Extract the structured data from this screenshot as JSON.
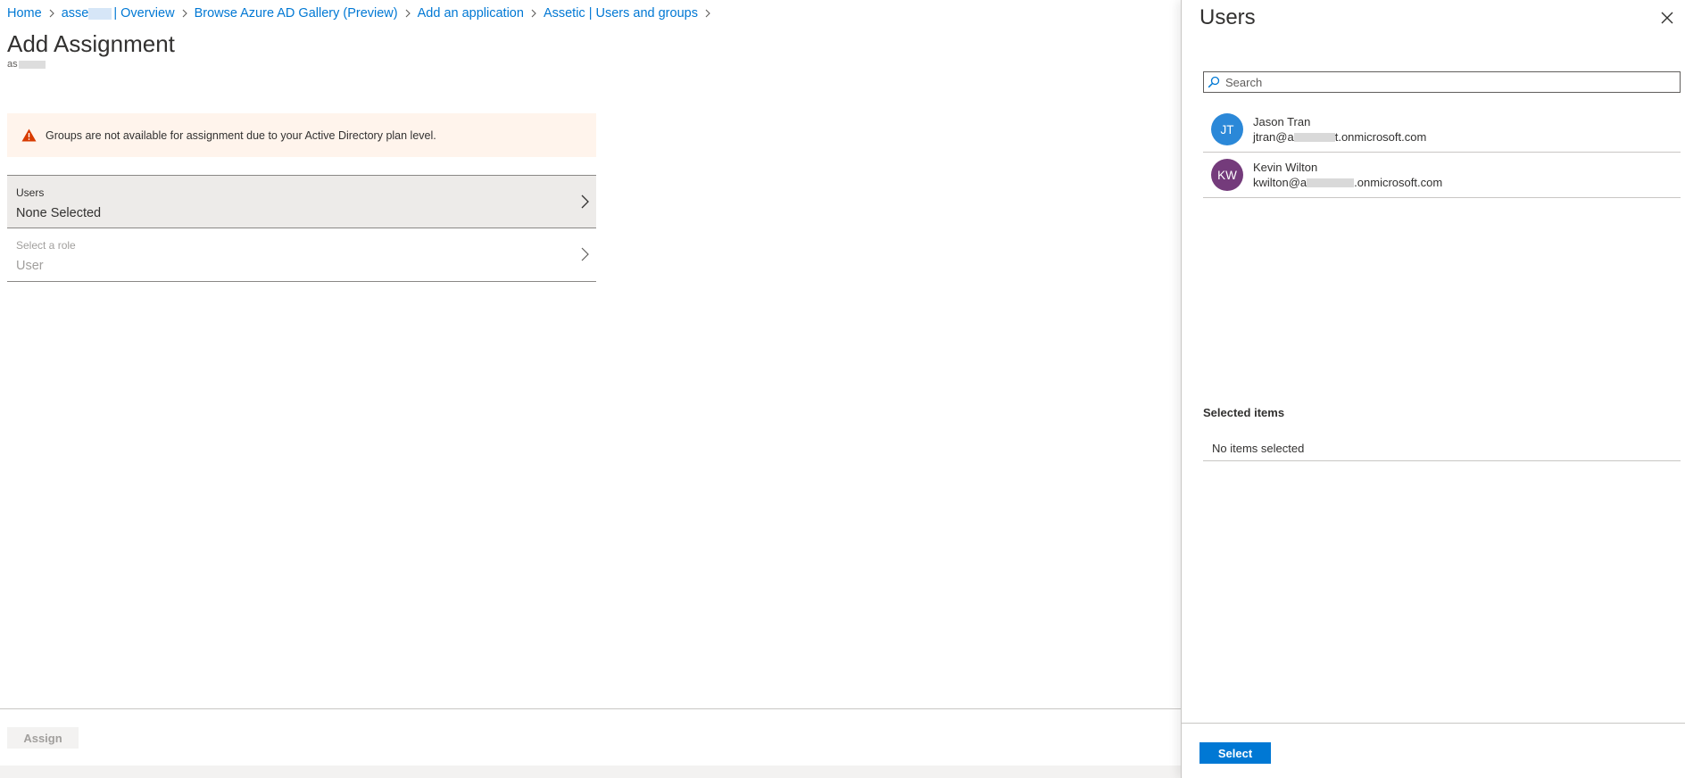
{
  "breadcrumb": {
    "items": [
      {
        "label": "Home"
      },
      {
        "label": "asse"
      },
      {
        "label": "| Overview"
      },
      {
        "label": "Browse Azure AD Gallery (Preview)"
      },
      {
        "label": "Add an application"
      },
      {
        "label": "Assetic | Users and groups"
      }
    ]
  },
  "page": {
    "title": "Add Assignment",
    "subtitle": "as"
  },
  "warning": {
    "text": "Groups are not available for assignment due to your Active Directory plan level.",
    "icon": "warning-triangle-icon",
    "color": "#d83b01"
  },
  "assignment": {
    "users": {
      "label": "Users",
      "value": "None Selected"
    },
    "role": {
      "label": "Select a role",
      "value": "User"
    }
  },
  "footer": {
    "assign_label": "Assign"
  },
  "panel": {
    "title": "Users",
    "search_placeholder": "Search",
    "users": [
      {
        "initials": "JT",
        "name": "Jason Tran",
        "email_prefix": "jtran@a",
        "email_suffix": "t.onmicrosoft.com",
        "color": "#2b88d8"
      },
      {
        "initials": "KW",
        "name": "Kevin Wilton",
        "email_prefix": "kwilton@a",
        "email_suffix": ".onmicrosoft.com",
        "color": "#743b7b"
      }
    ],
    "selected_heading": "Selected items",
    "no_items": "No items selected",
    "select_label": "Select"
  },
  "colors": {
    "accent": "#0078d4",
    "warning_bg": "#fff4ec"
  }
}
